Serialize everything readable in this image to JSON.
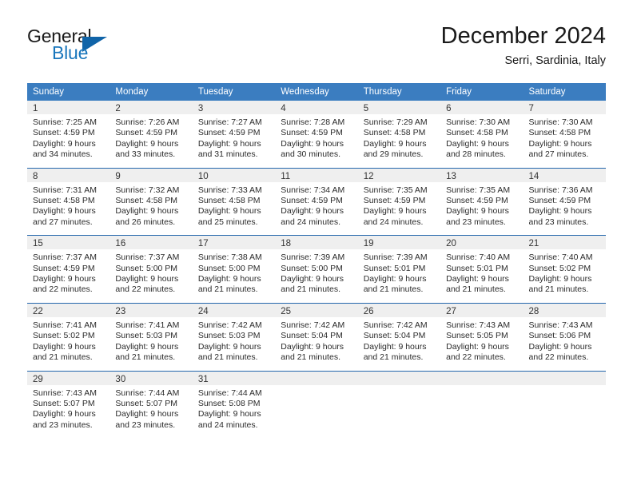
{
  "brand": {
    "line1": "General",
    "line2": "Blue",
    "colors": {
      "dark": "#1a1a1a",
      "blue": "#1976bc",
      "triangle": "#1064a8"
    }
  },
  "header": {
    "title": "December 2024",
    "subtitle": "Serri, Sardinia, Italy"
  },
  "colors": {
    "header_bg": "#3b7dc0",
    "header_text": "#ffffff",
    "week_divider": "#2467ac",
    "daynum_bg": "#efefef"
  },
  "weekday_headers": [
    "Sunday",
    "Monday",
    "Tuesday",
    "Wednesday",
    "Thursday",
    "Friday",
    "Saturday"
  ],
  "weeks": [
    [
      {
        "day": "1",
        "sunrise": "Sunrise: 7:25 AM",
        "sunset": "Sunset: 4:59 PM",
        "daylight1": "Daylight: 9 hours",
        "daylight2": "and 34 minutes."
      },
      {
        "day": "2",
        "sunrise": "Sunrise: 7:26 AM",
        "sunset": "Sunset: 4:59 PM",
        "daylight1": "Daylight: 9 hours",
        "daylight2": "and 33 minutes."
      },
      {
        "day": "3",
        "sunrise": "Sunrise: 7:27 AM",
        "sunset": "Sunset: 4:59 PM",
        "daylight1": "Daylight: 9 hours",
        "daylight2": "and 31 minutes."
      },
      {
        "day": "4",
        "sunrise": "Sunrise: 7:28 AM",
        "sunset": "Sunset: 4:59 PM",
        "daylight1": "Daylight: 9 hours",
        "daylight2": "and 30 minutes."
      },
      {
        "day": "5",
        "sunrise": "Sunrise: 7:29 AM",
        "sunset": "Sunset: 4:58 PM",
        "daylight1": "Daylight: 9 hours",
        "daylight2": "and 29 minutes."
      },
      {
        "day": "6",
        "sunrise": "Sunrise: 7:30 AM",
        "sunset": "Sunset: 4:58 PM",
        "daylight1": "Daylight: 9 hours",
        "daylight2": "and 28 minutes."
      },
      {
        "day": "7",
        "sunrise": "Sunrise: 7:30 AM",
        "sunset": "Sunset: 4:58 PM",
        "daylight1": "Daylight: 9 hours",
        "daylight2": "and 27 minutes."
      }
    ],
    [
      {
        "day": "8",
        "sunrise": "Sunrise: 7:31 AM",
        "sunset": "Sunset: 4:58 PM",
        "daylight1": "Daylight: 9 hours",
        "daylight2": "and 27 minutes."
      },
      {
        "day": "9",
        "sunrise": "Sunrise: 7:32 AM",
        "sunset": "Sunset: 4:58 PM",
        "daylight1": "Daylight: 9 hours",
        "daylight2": "and 26 minutes."
      },
      {
        "day": "10",
        "sunrise": "Sunrise: 7:33 AM",
        "sunset": "Sunset: 4:58 PM",
        "daylight1": "Daylight: 9 hours",
        "daylight2": "and 25 minutes."
      },
      {
        "day": "11",
        "sunrise": "Sunrise: 7:34 AM",
        "sunset": "Sunset: 4:59 PM",
        "daylight1": "Daylight: 9 hours",
        "daylight2": "and 24 minutes."
      },
      {
        "day": "12",
        "sunrise": "Sunrise: 7:35 AM",
        "sunset": "Sunset: 4:59 PM",
        "daylight1": "Daylight: 9 hours",
        "daylight2": "and 24 minutes."
      },
      {
        "day": "13",
        "sunrise": "Sunrise: 7:35 AM",
        "sunset": "Sunset: 4:59 PM",
        "daylight1": "Daylight: 9 hours",
        "daylight2": "and 23 minutes."
      },
      {
        "day": "14",
        "sunrise": "Sunrise: 7:36 AM",
        "sunset": "Sunset: 4:59 PM",
        "daylight1": "Daylight: 9 hours",
        "daylight2": "and 23 minutes."
      }
    ],
    [
      {
        "day": "15",
        "sunrise": "Sunrise: 7:37 AM",
        "sunset": "Sunset: 4:59 PM",
        "daylight1": "Daylight: 9 hours",
        "daylight2": "and 22 minutes."
      },
      {
        "day": "16",
        "sunrise": "Sunrise: 7:37 AM",
        "sunset": "Sunset: 5:00 PM",
        "daylight1": "Daylight: 9 hours",
        "daylight2": "and 22 minutes."
      },
      {
        "day": "17",
        "sunrise": "Sunrise: 7:38 AM",
        "sunset": "Sunset: 5:00 PM",
        "daylight1": "Daylight: 9 hours",
        "daylight2": "and 21 minutes."
      },
      {
        "day": "18",
        "sunrise": "Sunrise: 7:39 AM",
        "sunset": "Sunset: 5:00 PM",
        "daylight1": "Daylight: 9 hours",
        "daylight2": "and 21 minutes."
      },
      {
        "day": "19",
        "sunrise": "Sunrise: 7:39 AM",
        "sunset": "Sunset: 5:01 PM",
        "daylight1": "Daylight: 9 hours",
        "daylight2": "and 21 minutes."
      },
      {
        "day": "20",
        "sunrise": "Sunrise: 7:40 AM",
        "sunset": "Sunset: 5:01 PM",
        "daylight1": "Daylight: 9 hours",
        "daylight2": "and 21 minutes."
      },
      {
        "day": "21",
        "sunrise": "Sunrise: 7:40 AM",
        "sunset": "Sunset: 5:02 PM",
        "daylight1": "Daylight: 9 hours",
        "daylight2": "and 21 minutes."
      }
    ],
    [
      {
        "day": "22",
        "sunrise": "Sunrise: 7:41 AM",
        "sunset": "Sunset: 5:02 PM",
        "daylight1": "Daylight: 9 hours",
        "daylight2": "and 21 minutes."
      },
      {
        "day": "23",
        "sunrise": "Sunrise: 7:41 AM",
        "sunset": "Sunset: 5:03 PM",
        "daylight1": "Daylight: 9 hours",
        "daylight2": "and 21 minutes."
      },
      {
        "day": "24",
        "sunrise": "Sunrise: 7:42 AM",
        "sunset": "Sunset: 5:03 PM",
        "daylight1": "Daylight: 9 hours",
        "daylight2": "and 21 minutes."
      },
      {
        "day": "25",
        "sunrise": "Sunrise: 7:42 AM",
        "sunset": "Sunset: 5:04 PM",
        "daylight1": "Daylight: 9 hours",
        "daylight2": "and 21 minutes."
      },
      {
        "day": "26",
        "sunrise": "Sunrise: 7:42 AM",
        "sunset": "Sunset: 5:04 PM",
        "daylight1": "Daylight: 9 hours",
        "daylight2": "and 21 minutes."
      },
      {
        "day": "27",
        "sunrise": "Sunrise: 7:43 AM",
        "sunset": "Sunset: 5:05 PM",
        "daylight1": "Daylight: 9 hours",
        "daylight2": "and 22 minutes."
      },
      {
        "day": "28",
        "sunrise": "Sunrise: 7:43 AM",
        "sunset": "Sunset: 5:06 PM",
        "daylight1": "Daylight: 9 hours",
        "daylight2": "and 22 minutes."
      }
    ],
    [
      {
        "day": "29",
        "sunrise": "Sunrise: 7:43 AM",
        "sunset": "Sunset: 5:07 PM",
        "daylight1": "Daylight: 9 hours",
        "daylight2": "and 23 minutes."
      },
      {
        "day": "30",
        "sunrise": "Sunrise: 7:44 AM",
        "sunset": "Sunset: 5:07 PM",
        "daylight1": "Daylight: 9 hours",
        "daylight2": "and 23 minutes."
      },
      {
        "day": "31",
        "sunrise": "Sunrise: 7:44 AM",
        "sunset": "Sunset: 5:08 PM",
        "daylight1": "Daylight: 9 hours",
        "daylight2": "and 24 minutes."
      },
      {
        "day": "",
        "sunrise": "",
        "sunset": "",
        "daylight1": "",
        "daylight2": ""
      },
      {
        "day": "",
        "sunrise": "",
        "sunset": "",
        "daylight1": "",
        "daylight2": ""
      },
      {
        "day": "",
        "sunrise": "",
        "sunset": "",
        "daylight1": "",
        "daylight2": ""
      },
      {
        "day": "",
        "sunrise": "",
        "sunset": "",
        "daylight1": "",
        "daylight2": ""
      }
    ]
  ]
}
